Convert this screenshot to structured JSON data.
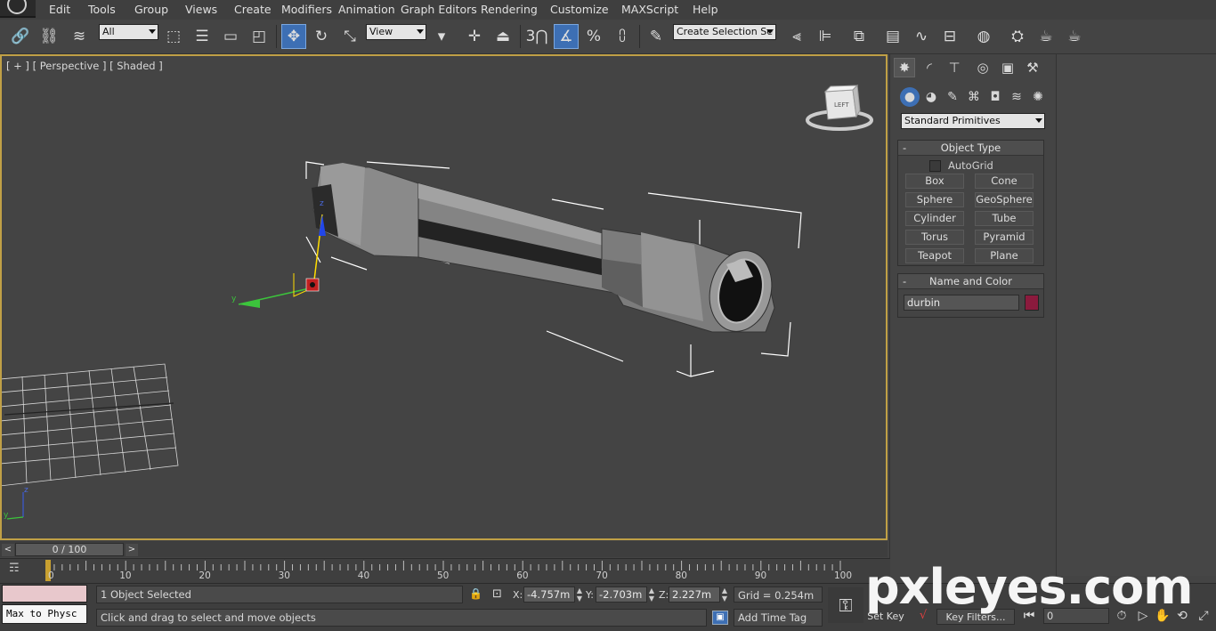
{
  "menu": [
    "Edit",
    "Tools",
    "Group",
    "Views",
    "Create",
    "Modifiers",
    "Animation",
    "Graph Editors",
    "Rendering",
    "Customize",
    "MAXScript",
    "Help"
  ],
  "toolbar": {
    "selection_filter": "All",
    "reference_coord": "View",
    "named_selection": "Create Selection Se",
    "snap_label": "3"
  },
  "viewport": {
    "label": "[ + ] [ Perspective ] [ Shaded ]",
    "viewcube_face": "LEFT",
    "axis_y": "y",
    "axis_z": "z"
  },
  "command_panel": {
    "category": "Standard Primitives",
    "object_type_title": "Object Type",
    "autogrid_label": "AutoGrid",
    "primitives": [
      "Box",
      "Cone",
      "Sphere",
      "GeoSphere",
      "Cylinder",
      "Tube",
      "Torus",
      "Pyramid",
      "Teapot",
      "Plane"
    ],
    "name_color_title": "Name and Color",
    "object_name": "durbin",
    "object_color": "#8b1a3d",
    "collapse_symbol": "-"
  },
  "time_slider": {
    "position": "0 / 100",
    "prev": "<",
    "next": ">"
  },
  "track_bar": {
    "ticks": [
      "0",
      "10",
      "20",
      "30",
      "40",
      "50",
      "60",
      "70",
      "80",
      "90",
      "100"
    ]
  },
  "status": {
    "maxscript_text": "Max to Physc",
    "selection_count": "1 Object Selected",
    "prompt": "Click and drag to select and move objects",
    "x_label": "X:",
    "x_value": "-4.757m",
    "y_label": "Y:",
    "y_value": "-2.703m",
    "z_label": "Z:",
    "z_value": "2.227m",
    "grid": "Grid = 0.254m",
    "add_time_tag": "Add Time Tag",
    "set_key": "Set Key",
    "key_filters": "Key Filters...",
    "frame": "0"
  },
  "watermark": "pxleyes.com",
  "colors": {
    "active_viewport_border": "#c0a046",
    "active_tool": "#3d6fb4"
  }
}
